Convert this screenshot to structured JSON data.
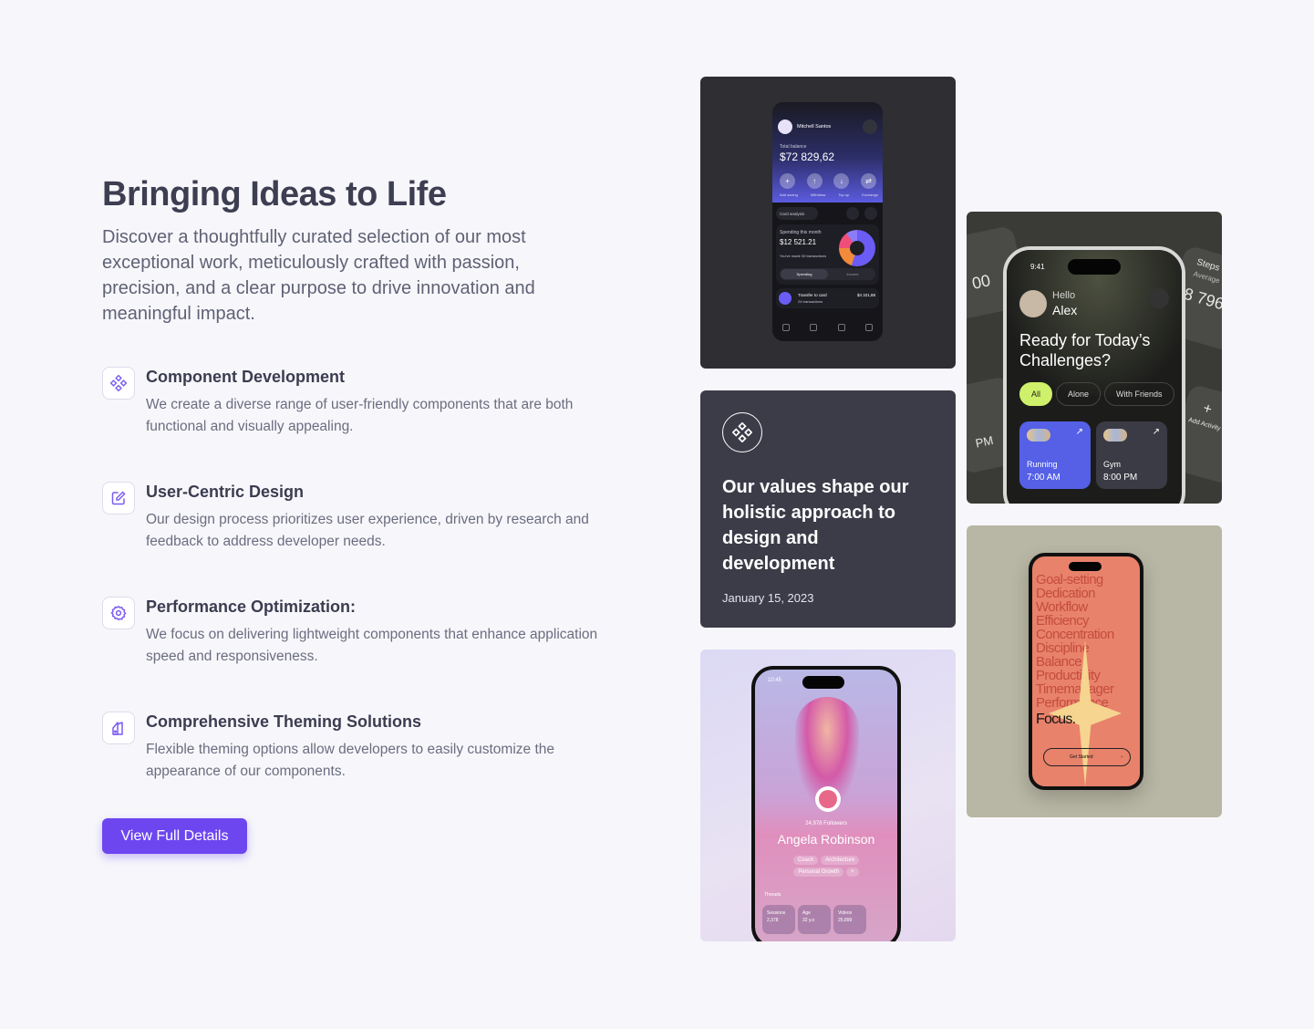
{
  "section": {
    "title": "Bringing Ideas to Life",
    "intro": "Discover a thoughtfully curated selection of our most exceptional work, meticulously crafted with passion, precision, and a clear purpose to drive innovation and meaningful impact."
  },
  "features": [
    {
      "icon": "components-icon",
      "title": "Component Development",
      "desc": "We create a diverse range of user-friendly components that are both functional and visually appealing."
    },
    {
      "icon": "edit-icon",
      "title": "User-Centric Design",
      "desc": "Our design process prioritizes user experience, driven by research and feedback to address developer needs."
    },
    {
      "icon": "gear-icon",
      "title": "Performance Optimization:",
      "desc": "We focus on delivering lightweight components that enhance application speed and responsiveness."
    },
    {
      "icon": "theme-icon",
      "title": "Comprehensive Theming Solutions",
      "desc": "Flexible theming options allow developers to easily customize the appearance of our components."
    }
  ],
  "cta": {
    "label": "View Full Details"
  },
  "values_card": {
    "text": "Our values shape our holistic approach to design and development",
    "date": "January 15, 2023"
  },
  "finance_app": {
    "user": "Mitchell Santos",
    "balance_label": "Total balance",
    "balance": "$72 829,62",
    "actions": [
      "Add saving",
      "Withdraw",
      "Top up",
      "Exchange"
    ],
    "chip": "Card analysis",
    "spending_label": "Spending this month",
    "spending": "$12 521.21",
    "spending_note": "You've made 30 transactions",
    "tab_on": "Spending",
    "tab_off": "Income",
    "transfer_label": "Transfer to card",
    "transfer_sub": "24 transactions",
    "transfer_amount": "$4 321,88"
  },
  "fitness_app": {
    "time": "9:41",
    "hello": "Hello",
    "name": "Alex",
    "headline": "Ready for Today’s Challenges?",
    "filters": [
      "All",
      "Alone",
      "With Friends"
    ],
    "tiles": [
      {
        "name": "Running",
        "time": "7:00 AM"
      },
      {
        "name": "Gym",
        "time": "8:00 PM"
      }
    ],
    "steps_label": "Steps",
    "steps_sub": "Average",
    "steps_value": "8 796",
    "left_value": "00",
    "left_time": "PM",
    "add_label": "Add Activity"
  },
  "profile_app": {
    "time": "10:45",
    "followers": "24,978",
    "followers_label": "Followers",
    "name": "Angela Robinson",
    "tags": [
      "Coach",
      "Architecture",
      "Personal Growth",
      "+"
    ],
    "threads": "Threads",
    "stats": [
      {
        "label": "Sessions",
        "value": "2,378"
      },
      {
        "label": "Age",
        "value": "32 y.o"
      },
      {
        "label": "Videos",
        "value": "25,899"
      }
    ]
  },
  "focus_app": {
    "words": [
      "Goal-setting",
      "Dedication",
      "Workflow",
      "Efficiency",
      "Concentration",
      "Discipline",
      "Balance",
      "Productivity",
      "Timemanager",
      "Performance"
    ],
    "focus": "Focus.",
    "button": "Get Started"
  },
  "colors": {
    "accent": "#6d46f0",
    "dark_card": "#3b3c48",
    "page_bg": "#f7f7fb"
  }
}
